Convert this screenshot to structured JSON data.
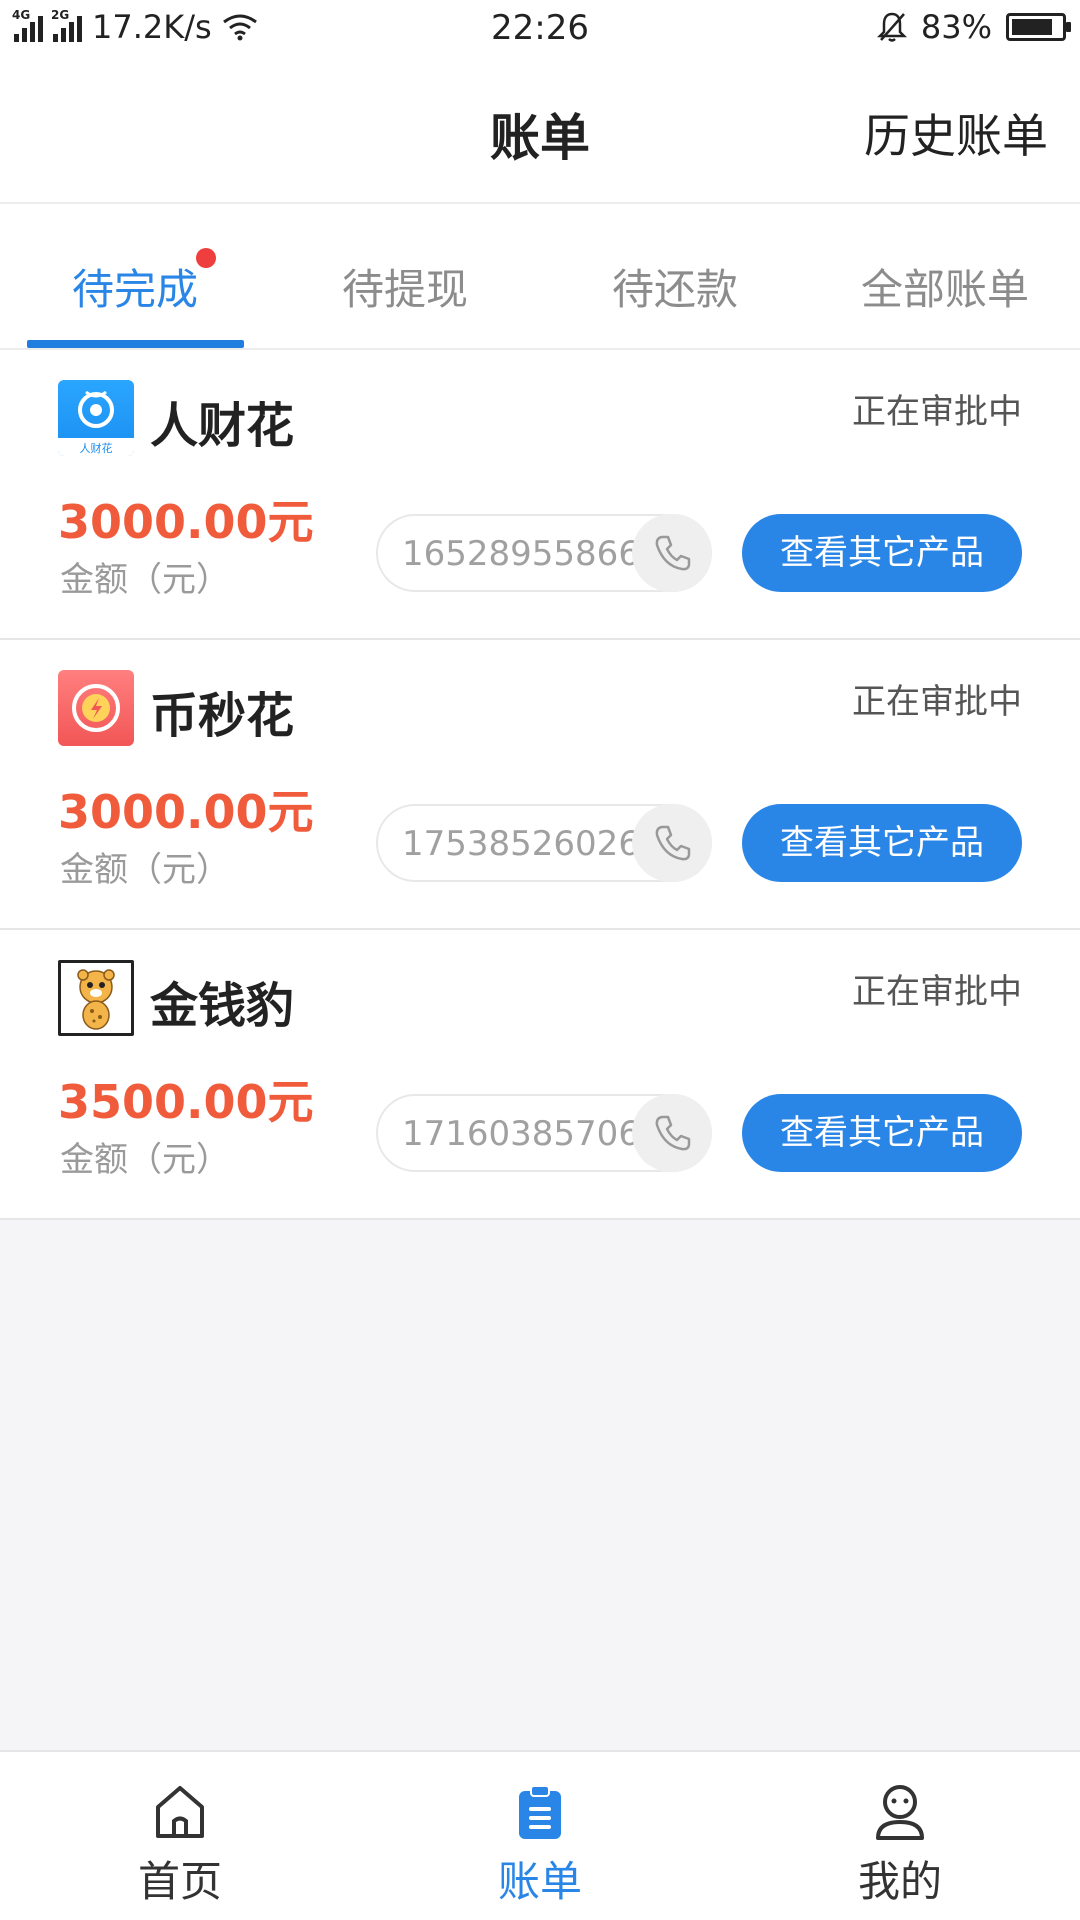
{
  "status_bar": {
    "network1": "4G",
    "network2": "2G",
    "speed": "17.2K/s",
    "time": "22:26",
    "battery": "83%",
    "battery_level": 0.83
  },
  "header": {
    "title": "账单",
    "history": "历史账单"
  },
  "tabs": [
    {
      "label": "待完成",
      "active": true,
      "badge": true
    },
    {
      "label": "待提现",
      "active": false
    },
    {
      "label": "待还款",
      "active": false
    },
    {
      "label": "全部账单",
      "active": false
    }
  ],
  "bills": [
    {
      "name": "人财花",
      "logo_text": "人财花",
      "status": "正在审批中",
      "amount": "3000.00元",
      "amount_label": "金额（元）",
      "phone": "16528955866",
      "button": "查看其它产品"
    },
    {
      "name": "币秒花",
      "status": "正在审批中",
      "amount": "3000.00元",
      "amount_label": "金额（元）",
      "phone": "17538526026",
      "button": "查看其它产品"
    },
    {
      "name": "金钱豹",
      "status": "正在审批中",
      "amount": "3500.00元",
      "amount_label": "金额（元）",
      "phone": "17160385706",
      "button": "查看其它产品"
    }
  ],
  "bottom_nav": [
    {
      "label": "首页",
      "icon": "home-icon",
      "active": false
    },
    {
      "label": "账单",
      "icon": "bill-icon",
      "active": true
    },
    {
      "label": "我的",
      "icon": "profile-icon",
      "active": false
    }
  ],
  "colors": {
    "accent": "#2a86e6",
    "amount": "#f05b3b",
    "badge": "#ef3e3e"
  }
}
